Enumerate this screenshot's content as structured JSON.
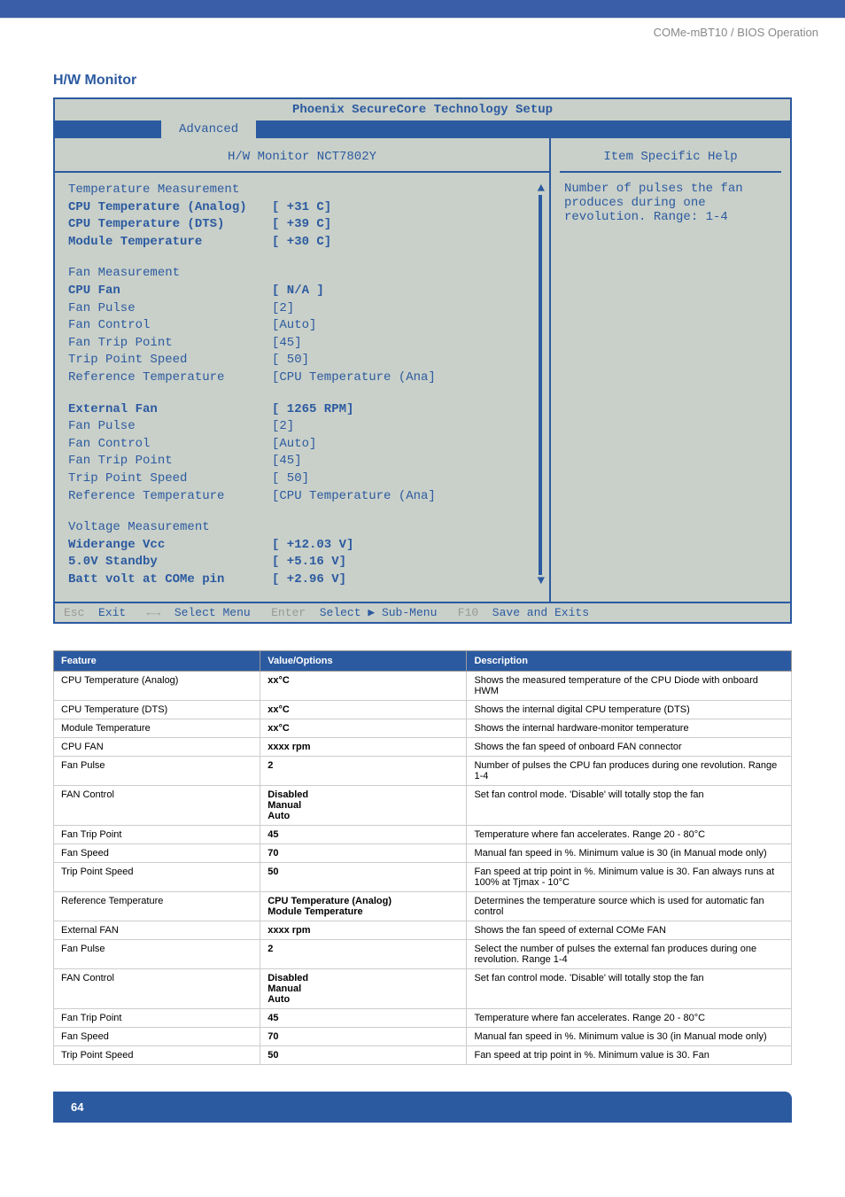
{
  "header": {
    "breadcrumb": "COMe-mBT10 / BIOS Operation",
    "section_title": "H/W Monitor"
  },
  "bios": {
    "title": "Phoenix SecureCore Technology Setup",
    "tab": "Advanced",
    "panel_title": "H/W Monitor NCT7802Y",
    "help_title": "Item Specific Help",
    "help_text": "Number of pulses the fan produces during one revolution. Range: 1-4",
    "temp_heading": "Temperature Measurement",
    "rows_temp": [
      {
        "label": "CPU Temperature (Analog)",
        "value": "[ +31 C]",
        "bold": true
      },
      {
        "label": "CPU Temperature (DTS)",
        "value": "[ +39 C]",
        "bold": true
      },
      {
        "label": "Module Temperature",
        "value": "[ +30 C]",
        "bold": true
      }
    ],
    "fan_heading": "Fan Measurement",
    "rows_fan": [
      {
        "label": "CPU Fan",
        "value": "[ N/A    ]",
        "bold": true
      },
      {
        "label": "Fan Pulse",
        "value": "[2]",
        "bold": false
      },
      {
        "label": "Fan Control",
        "value": "[Auto]",
        "bold": false
      },
      {
        "label": "Fan Trip Point",
        "value": "[45]",
        "bold": false
      },
      {
        "label": "Trip Point Speed",
        "value": "[ 50]",
        "bold": false
      },
      {
        "label": "Reference Temperature",
        "value": "[CPU Temperature (Ana]",
        "bold": false
      }
    ],
    "ext_heading": "External Fan",
    "ext_value": "[ 1265 RPM]",
    "rows_ext": [
      {
        "label": "Fan Pulse",
        "value": "[2]",
        "bold": false
      },
      {
        "label": "Fan Control",
        "value": "[Auto]",
        "bold": false
      },
      {
        "label": "Fan Trip Point",
        "value": "[45]",
        "bold": false
      },
      {
        "label": "Trip Point Speed",
        "value": "[ 50]",
        "bold": false
      },
      {
        "label": "Reference Temperature",
        "value": "[CPU Temperature (Ana]",
        "bold": false
      }
    ],
    "volt_heading": "Voltage Measurement",
    "rows_volt": [
      {
        "label": "Widerange Vcc",
        "value": "[ +12.03 V]",
        "bold": true
      },
      {
        "label": "5.0V Standby",
        "value": "[ +5.16 V]",
        "bold": true
      },
      {
        "label": "Batt volt at COMe pin",
        "value": "[ +2.96 V]",
        "bold": true
      }
    ],
    "footer": {
      "esc": "Esc",
      "exit": "Exit",
      "arrows": "←→",
      "select_menu": "Select Menu",
      "enter": "Enter",
      "select_sub": "Select ▶ Sub-Menu",
      "f10": "F10",
      "save": "Save and Exits"
    }
  },
  "table": {
    "headers": [
      "Feature",
      "Value/Options",
      "Description"
    ],
    "rows": [
      [
        "CPU Temperature (Analog)",
        "xx°C",
        "Shows the measured temperature of the CPU Diode with onboard HWM"
      ],
      [
        "CPU Temperature (DTS)",
        "xx°C",
        "Shows the internal digital CPU temperature (DTS)"
      ],
      [
        "Module Temperature",
        "xx°C",
        "Shows the internal hardware-monitor temperature"
      ],
      [
        "CPU FAN",
        "xxxx rpm",
        "Shows the fan speed of onboard FAN connector"
      ],
      [
        "Fan Pulse",
        "2",
        "Number of pulses the CPU fan produces during one revolution. Range 1-4"
      ],
      [
        "FAN Control",
        "Disabled\nManual\nAuto",
        "Set fan control mode. 'Disable' will totally stop the fan"
      ],
      [
        "Fan Trip Point",
        "45",
        "Temperature where fan accelerates. Range 20 - 80°C"
      ],
      [
        "Fan Speed",
        "70",
        "Manual fan speed in %. Minimum value is 30 (in Manual mode only)"
      ],
      [
        "Trip Point Speed",
        "50",
        "Fan speed at trip point in %. Minimum value is 30. Fan always runs at 100% at Tjmax - 10°C"
      ],
      [
        "Reference Temperature",
        "CPU Temperature (Analog)\nModule Temperature",
        "Determines the temperature source which is used for automatic fan control"
      ],
      [
        "External FAN",
        "xxxx rpm",
        "Shows the fan speed of external COMe FAN"
      ],
      [
        "Fan Pulse",
        "2",
        "Select the number of pulses the external fan produces during one revolution. Range 1-4"
      ],
      [
        "FAN Control",
        "Disabled\nManual\nAuto",
        "Set fan control mode. 'Disable' will totally stop the fan"
      ],
      [
        "Fan Trip Point",
        "45",
        "Temperature where fan accelerates. Range 20 - 80°C"
      ],
      [
        "Fan Speed",
        "70",
        "Manual fan speed in %. Minimum value is 30 (in Manual mode only)"
      ],
      [
        "Trip Point Speed",
        "50",
        "Fan speed at trip point in %. Minimum value is 30. Fan"
      ]
    ]
  },
  "page_number": "64"
}
